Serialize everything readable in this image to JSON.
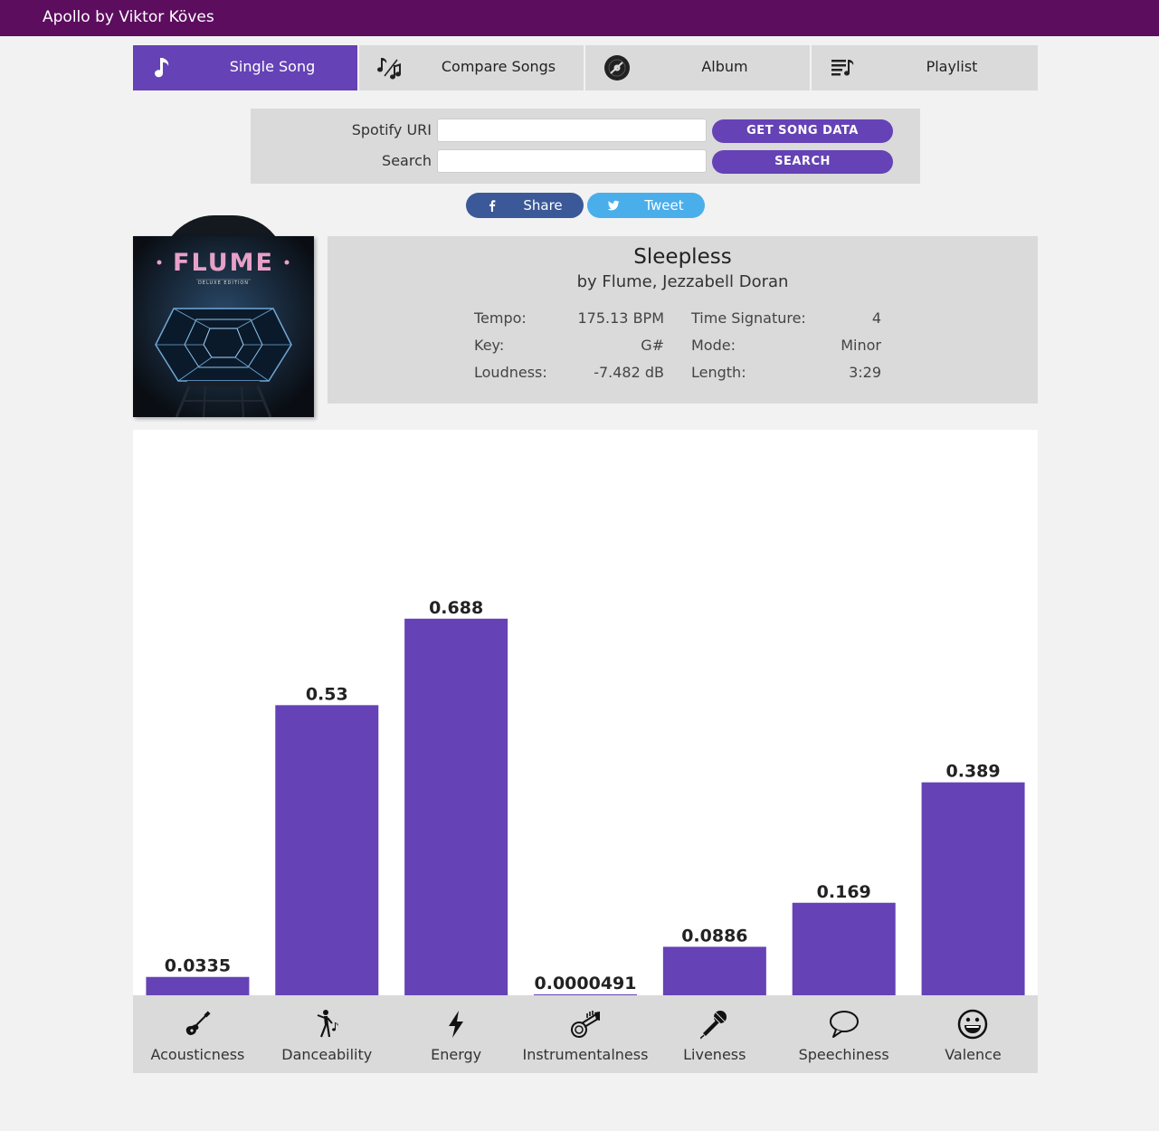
{
  "app": {
    "title": "Apollo by Viktor Köves"
  },
  "tabs": [
    {
      "label": "Single Song",
      "icon": "music-note-icon",
      "active": true
    },
    {
      "label": "Compare Songs",
      "icon": "compare-notes-icon",
      "active": false
    },
    {
      "label": "Album",
      "icon": "vinyl-record-icon",
      "active": false
    },
    {
      "label": "Playlist",
      "icon": "playlist-icon",
      "active": false
    }
  ],
  "search": {
    "uri_label": "Spotify URI",
    "uri_value": "",
    "uri_button": "GET SONG DATA",
    "search_label": "Search",
    "search_value": "",
    "search_button": "SEARCH"
  },
  "share": {
    "facebook": "Share",
    "twitter": "Tweet"
  },
  "album_art": {
    "artist_text": "FLUME",
    "edition_text": "DELUXE EDITION"
  },
  "song": {
    "title": "Sleepless",
    "artist": "by Flume, Jezzabell Doran",
    "stats": [
      {
        "label": "Tempo:",
        "value": "175.13 BPM"
      },
      {
        "label": "Time Signature:",
        "value": "4"
      },
      {
        "label": "Key:",
        "value": "G#"
      },
      {
        "label": "Mode:",
        "value": "Minor"
      },
      {
        "label": "Loudness:",
        "value": "-7.482 dB"
      },
      {
        "label": "Length:",
        "value": "3:29"
      }
    ]
  },
  "colors": {
    "accent": "#6542b6",
    "topbar": "#5c0d5e",
    "panel": "#dadada",
    "facebook": "#3b5998",
    "twitter": "#4aaeea"
  },
  "chart_data": {
    "type": "bar",
    "categories": [
      "Acousticness",
      "Danceability",
      "Energy",
      "Instrumentalness",
      "Liveness",
      "Speechiness",
      "Valence"
    ],
    "values": [
      0.0335,
      0.53,
      0.688,
      4.91e-05,
      0.0886,
      0.169,
      0.389
    ],
    "value_labels": [
      "0.0335",
      "0.53",
      "0.688",
      "0.0000491",
      "0.0886",
      "0.169",
      "0.389"
    ],
    "ylim": [
      0,
      1
    ],
    "grid": false,
    "bar_color": "#6542b6"
  },
  "features": [
    {
      "label": "Acousticness",
      "icon": "guitar-icon"
    },
    {
      "label": "Danceability",
      "icon": "dancer-icon"
    },
    {
      "label": "Energy",
      "icon": "lightning-icon"
    },
    {
      "label": "Instrumentalness",
      "icon": "trumpet-icon"
    },
    {
      "label": "Liveness",
      "icon": "microphone-icon"
    },
    {
      "label": "Speechiness",
      "icon": "speech-bubble-icon"
    },
    {
      "label": "Valence",
      "icon": "smiley-icon"
    }
  ]
}
